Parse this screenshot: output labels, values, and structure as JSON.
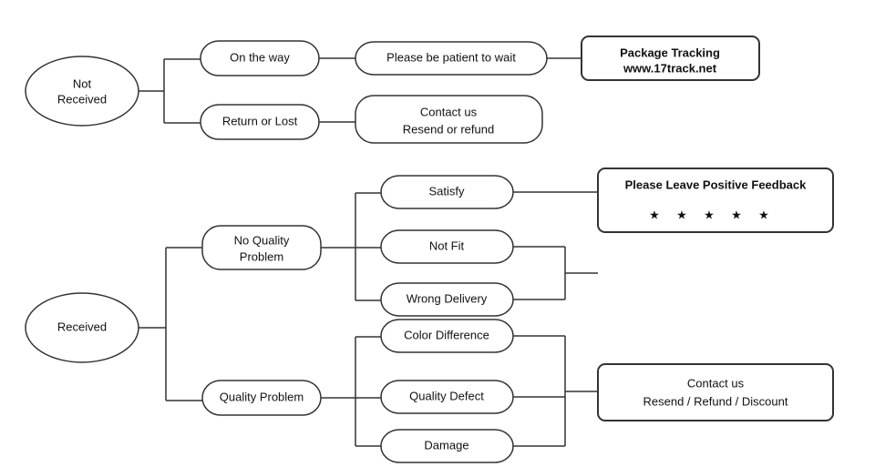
{
  "nodes": {
    "not_received": "Not\nReceived",
    "on_the_way": "On the way",
    "return_or_lost": "Return or Lost",
    "patient_wait": "Please be patient to wait",
    "package_tracking": "Package Tracking\nwww.17track.net",
    "contact_resend": "Contact us\nResend or refund",
    "received": "Received",
    "no_quality_problem": "No Quality\nProblem",
    "quality_problem": "Quality Problem",
    "satisfy": "Satisfy",
    "not_fit": "Not Fit",
    "wrong_delivery": "Wrong Delivery",
    "color_difference": "Color Difference",
    "quality_defect": "Quality Defect",
    "damage": "Damage",
    "positive_feedback": "Please Leave Positive Feedback",
    "contact_refund": "Contact us\nResend / Refund / Discount"
  },
  "stars": [
    "★",
    "★",
    "★",
    "★",
    "★"
  ]
}
